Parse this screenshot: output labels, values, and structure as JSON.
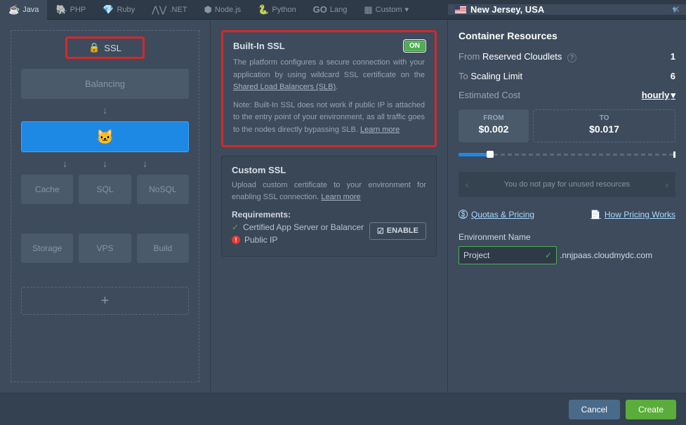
{
  "tabs": [
    "Java",
    "PHP",
    "Ruby",
    ".NET",
    "Node.js",
    "Python",
    "Lang",
    "Custom"
  ],
  "region": "New Jersey, USA",
  "topology": {
    "ssl": "SSL",
    "balancing": "Balancing",
    "row1": [
      "Cache",
      "SQL",
      "NoSQL"
    ],
    "row2": [
      "Storage",
      "VPS",
      "Build"
    ]
  },
  "builtin": {
    "title": "Built-In SSL",
    "state": "ON",
    "desc1": "The platform configures a secure connection with your application by using wildcard SSL certificate on the",
    "slb": "Shared Load Balancers (SLB)",
    "note": "Note: Built-In SSL does not work if public IP is attached to the entry point of your environment, as all traffic goes to the nodes directly bypassing SLB.",
    "learn": "Learn more"
  },
  "custom": {
    "title": "Custom SSL",
    "desc": "Upload custom certificate to your environment for enabling SSL connection.",
    "learn": "Learn more",
    "req_label": "Requirements:",
    "req1": "Certified App Server or Balancer",
    "req2": "Public IP",
    "enable": "ENABLE"
  },
  "res": {
    "title": "Container Resources",
    "from_lbl": "From",
    "reserved": "Reserved Cloudlets",
    "reserved_val": "1",
    "to_lbl": "To",
    "scaling": "Scaling Limit",
    "scaling_val": "6",
    "cost_lbl": "Estimated Cost",
    "period": "hourly",
    "from_box_lbl": "FROM",
    "from_price": "$0.002",
    "to_box_lbl": "TO",
    "to_price": "$0.017",
    "info": "You do not pay for unused resources",
    "quotas": "Quotas & Pricing",
    "pricing": "How Pricing Works"
  },
  "env": {
    "label": "Environment Name",
    "value": "Project",
    "domain": ".nnjpaas.cloudmydc.com"
  },
  "footer": {
    "cancel": "Cancel",
    "create": "Create"
  }
}
